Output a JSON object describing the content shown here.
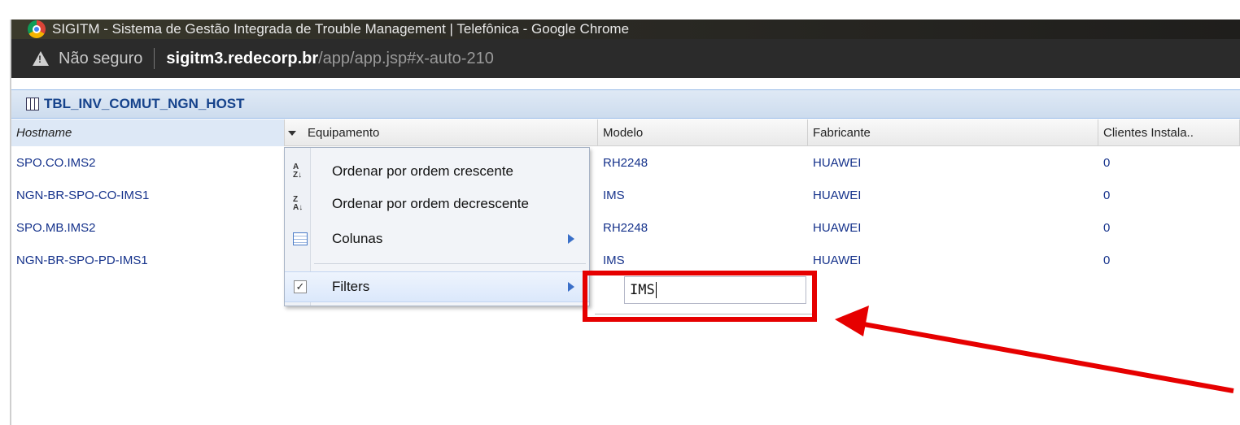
{
  "browser": {
    "window_title": "SIGITM - Sistema de Gestão Integrada de Trouble Management | Telefônica - Google Chrome",
    "security_label": "Não seguro",
    "url_host": "sigitm3.redecorp.br",
    "url_path": "/app/app.jsp#x-auto-210"
  },
  "panel": {
    "title": "TBL_INV_COMUT_NGN_HOST"
  },
  "grid": {
    "columns": [
      "Hostname",
      "Equipamento",
      "Modelo",
      "Fabricante",
      "Clientes Instala.."
    ],
    "rows": [
      {
        "hostname": "SPO.CO.IMS2",
        "modelo": "RH2248",
        "fabricante": "HUAWEI",
        "clientes": "0"
      },
      {
        "hostname": "NGN-BR-SPO-CO-IMS1",
        "modelo": "IMS",
        "fabricante": "HUAWEI",
        "clientes": "0"
      },
      {
        "hostname": "SPO.MB.IMS2",
        "modelo": "RH2248",
        "fabricante": "HUAWEI",
        "clientes": "0"
      },
      {
        "hostname": "NGN-BR-SPO-PD-IMS1",
        "modelo": "IMS",
        "fabricante": "HUAWEI",
        "clientes": "0"
      }
    ]
  },
  "column_menu": {
    "sort_asc": "Ordenar por ordem crescente",
    "sort_desc": "Ordenar por ordem decrescente",
    "columns": "Colunas",
    "filters": "Filters"
  },
  "filter": {
    "value": "IMS"
  },
  "annotation": {
    "color": "#e60000"
  }
}
